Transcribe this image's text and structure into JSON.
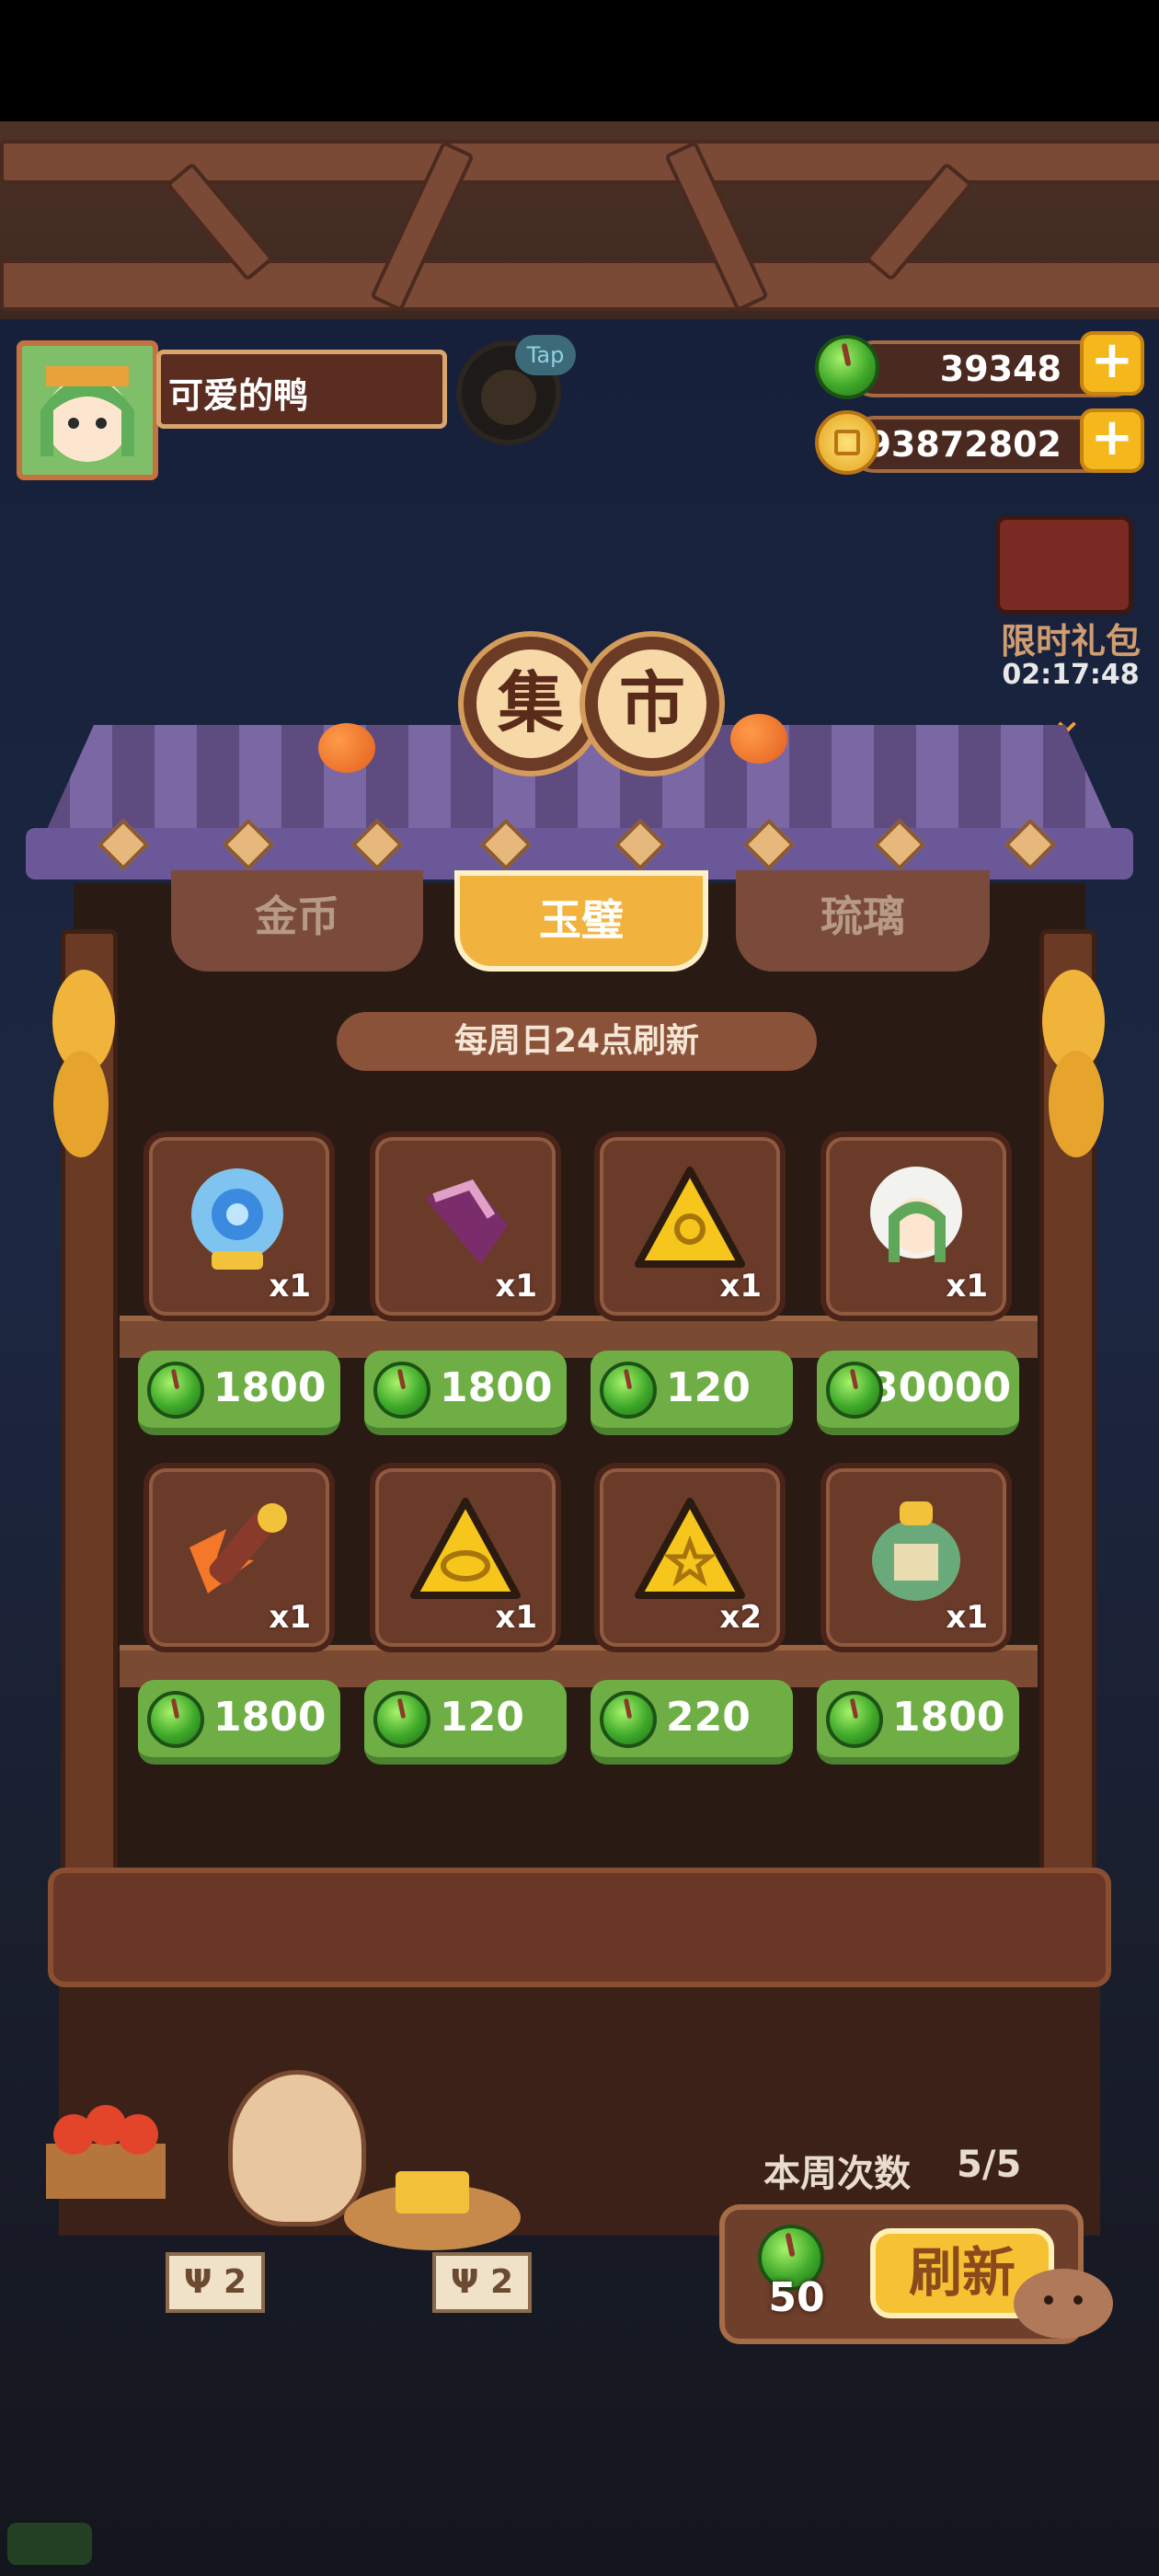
{
  "player": {
    "name": "可爱的鸭"
  },
  "tap_label": "Tap",
  "currency": {
    "jade": "39348",
    "coins": "93872802",
    "plus": "+"
  },
  "limited_pack": {
    "label": "限时礼包",
    "timer": "02:17:48",
    "arrow": "⌄"
  },
  "market_title": [
    "集",
    "市"
  ],
  "tabs": [
    {
      "label": "金币",
      "active": false
    },
    {
      "label": "玉璧",
      "active": true
    },
    {
      "label": "琉璃",
      "active": false
    }
  ],
  "refresh_note": "每周日24点刷新",
  "items": [
    {
      "icon": "blue-snail-shell-icon",
      "qty": "x1",
      "price": "1800"
    },
    {
      "icon": "purple-bucket-handle-icon",
      "qty": "x1",
      "price": "1800"
    },
    {
      "icon": "gold-triangle-token-icon",
      "qty": "x1",
      "price": "120"
    },
    {
      "icon": "green-haired-character-icon",
      "qty": "x1",
      "price": "30000"
    },
    {
      "icon": "fire-pen-icon",
      "qty": "x1",
      "price": "1800"
    },
    {
      "icon": "gold-fish-token-icon",
      "qty": "x1",
      "price": "120"
    },
    {
      "icon": "gold-star-token-icon",
      "qty": "x2",
      "price": "220"
    },
    {
      "icon": "green-scroll-jar-icon",
      "qty": "x1",
      "price": "1800"
    }
  ],
  "weekly": {
    "label": "本周次数",
    "count": "5/5"
  },
  "refresh": {
    "cost": "50",
    "button": "刷新"
  },
  "price_tags": [
    "Ψ 2",
    "Ψ 2"
  ],
  "colors": {
    "jade_green": "#6fae45",
    "gold": "#f2b33e",
    "wood": "#6b3b2a"
  }
}
